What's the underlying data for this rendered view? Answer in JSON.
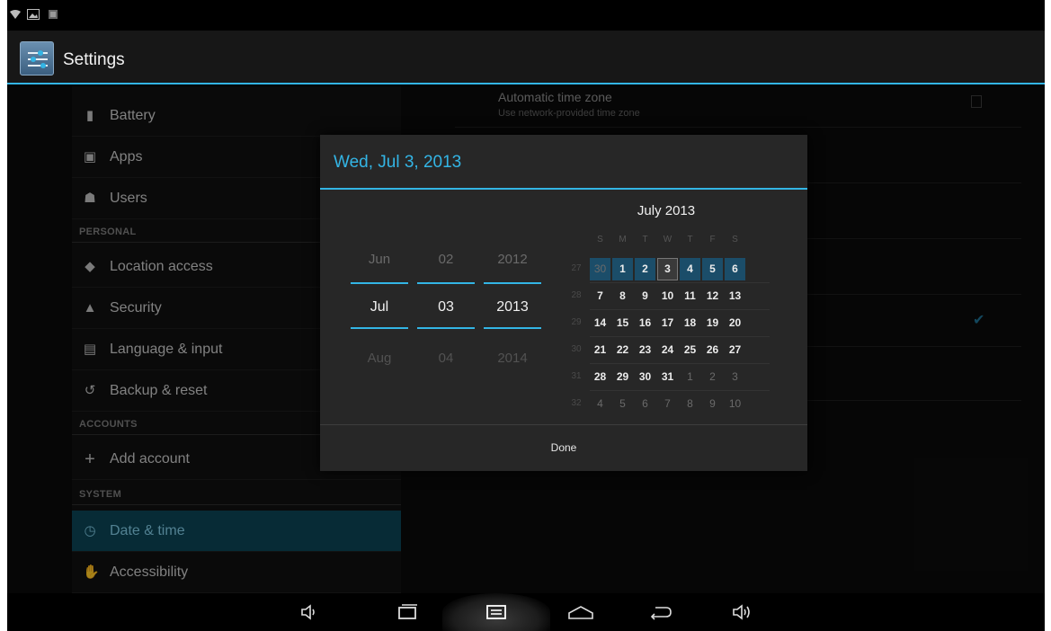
{
  "app": {
    "title": "Settings"
  },
  "status_bar": {
    "icons": [
      "wifi-icon",
      "picture-icon",
      "notification-icon"
    ]
  },
  "sidebar": {
    "items": [
      {
        "label": "Battery",
        "icon": "battery-icon"
      },
      {
        "label": "Apps",
        "icon": "apps-icon"
      },
      {
        "label": "Users",
        "icon": "users-icon"
      }
    ],
    "personal_header": "PERSONAL",
    "personal_items": [
      {
        "label": "Location access",
        "icon": "location-icon"
      },
      {
        "label": "Security",
        "icon": "lock-icon"
      },
      {
        "label": "Language & input",
        "icon": "keyboard-icon"
      },
      {
        "label": "Backup & reset",
        "icon": "backup-icon"
      }
    ],
    "accounts_header": "ACCOUNTS",
    "accounts_items": [
      {
        "label": "Add account",
        "icon": "plus-icon"
      }
    ],
    "system_header": "SYSTEM",
    "system_items": [
      {
        "label": "Date & time",
        "icon": "clock-icon",
        "selected": true
      },
      {
        "label": "Accessibility",
        "icon": "hand-icon"
      }
    ]
  },
  "main": {
    "automatic_time_zone": {
      "title": "Automatic time zone",
      "summary": "Use network-provided time zone",
      "checked": false
    },
    "use_24_hour_checked": true
  },
  "dialog": {
    "title": "Wed, Jul 3, 2013",
    "spinners": {
      "month": {
        "prev": "Jun",
        "current": "Jul",
        "next": "Aug"
      },
      "day": {
        "prev": "02",
        "current": "03",
        "next": "04"
      },
      "year": {
        "prev": "2012",
        "current": "2013",
        "next": "2014"
      }
    },
    "calendar": {
      "month_label": "July 2013",
      "weekdays": [
        "S",
        "M",
        "T",
        "W",
        "T",
        "F",
        "S"
      ],
      "weeks": [
        {
          "num": "27",
          "days": [
            "30",
            "1",
            "2",
            "3",
            "4",
            "5",
            "6"
          ]
        },
        {
          "num": "28",
          "days": [
            "7",
            "8",
            "9",
            "10",
            "11",
            "12",
            "13"
          ]
        },
        {
          "num": "29",
          "days": [
            "14",
            "15",
            "16",
            "17",
            "18",
            "19",
            "20"
          ]
        },
        {
          "num": "30",
          "days": [
            "21",
            "22",
            "23",
            "24",
            "25",
            "26",
            "27"
          ]
        },
        {
          "num": "31",
          "days": [
            "28",
            "29",
            "30",
            "31",
            "1",
            "2",
            "3"
          ]
        },
        {
          "num": "32",
          "days": [
            "4",
            "5",
            "6",
            "7",
            "8",
            "9",
            "10"
          ]
        }
      ],
      "selected_day": "3"
    },
    "done_label": "Done"
  },
  "nav_bar": {
    "buttons": [
      "volume-down-icon",
      "recent-apps-icon",
      "screenshot-icon",
      "home-icon",
      "back-icon",
      "volume-up-icon"
    ]
  },
  "colors": {
    "accent": "#33b5e5",
    "selection": "#0b4354",
    "week_highlight": "#1b4d69"
  }
}
